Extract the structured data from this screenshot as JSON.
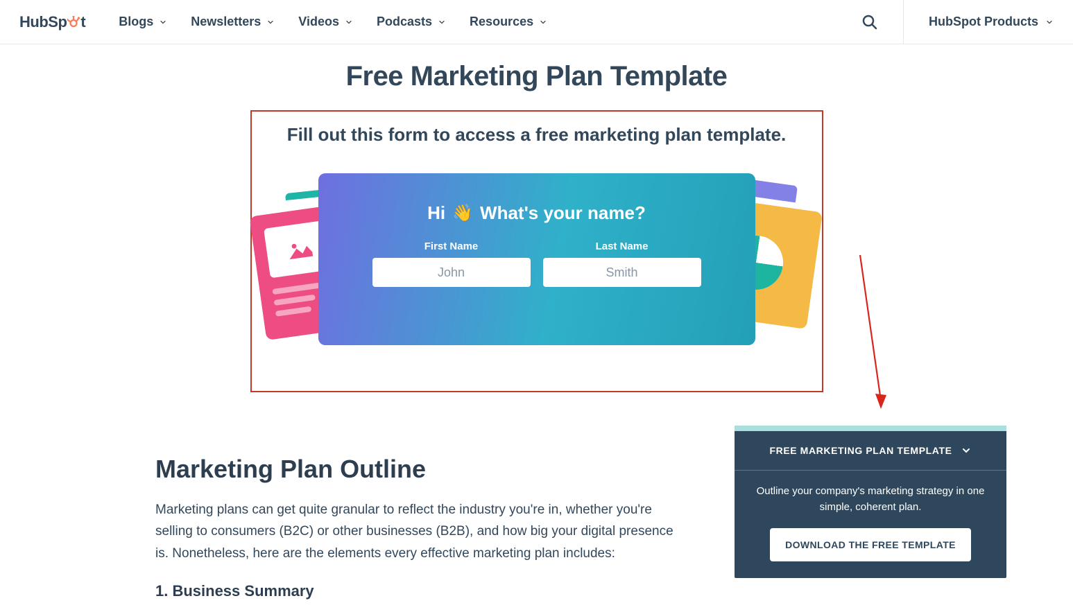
{
  "nav": {
    "logo_text_pre": "HubSp",
    "logo_text_post": "t",
    "items": [
      {
        "label": "Blogs"
      },
      {
        "label": "Newsletters"
      },
      {
        "label": "Videos"
      },
      {
        "label": "Podcasts"
      },
      {
        "label": "Resources"
      }
    ],
    "products_label": "HubSpot Products"
  },
  "hero": {
    "title": "Free Marketing Plan Template",
    "lead": "Fill out this form to access a free marketing plan template.",
    "form": {
      "question_pre": "Hi",
      "question_post": "What's your name?",
      "first_name_label": "First Name",
      "first_name_placeholder": "John",
      "last_name_label": "Last Name",
      "last_name_placeholder": "Smith"
    }
  },
  "article": {
    "heading": "Marketing Plan Outline",
    "paragraph": "Marketing plans can get quite granular to reflect the industry you're in, whether you're selling to consumers (B2C) or other businesses (B2B), and how big your digital presence is. Nonetheless, here are the elements every effective marketing plan includes:",
    "subheading": "1. Business Summary"
  },
  "slidein": {
    "title": "FREE MARKETING PLAN TEMPLATE",
    "description": "Outline your company's marketing strategy in one simple, coherent plan.",
    "cta": "DOWNLOAD THE FREE TEMPLATE"
  }
}
